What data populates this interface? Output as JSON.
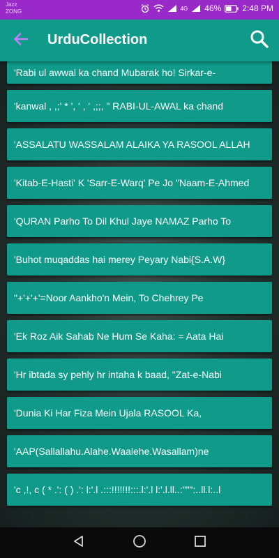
{
  "status_bar": {
    "carrier_line1": "Jazz",
    "carrier_line2": "ZONG",
    "network": "4G",
    "battery": "46%",
    "time": "2:48 PM"
  },
  "app_bar": {
    "title": "UrduCollection",
    "back_icon": "arrow-left-icon",
    "search_icon": "search-icon"
  },
  "colors": {
    "status_bar": "#9a29c9",
    "app_bar": "#0f9a8a",
    "card": "#0f9a8a",
    "back_arrow": "#c77dff",
    "nav_bar": "#0a0a0a"
  },
  "list": {
    "items": [
      "'Rabi ul awwal ka chand Mubarak ho!  Sirkar-e-",
      "'kanwal , ,;' * ', ' , ' ,;;, \"  RABI-UL-AWAL ka chand",
      "'ASSALATU WASSALAM ALAIKA YA RASOOL ALLAH",
      "'Kitab-E-Hasti' K 'Sarr-E-Warq' Pe Jo \"Naam-E-Ahmed",
      "'QURAN Parho To Dil Khul Jaye  NAMAZ Parho To",
      "'Buhot muqaddas hai merey Peyary Nabi{S.A.W}",
      "\"+'+'+'=Noor Aankho'n Mein, To Chehrey Pe",
      "'Ek Roz Aik Sahab Ne Hum Se Kaha: = Aata Hai",
      "'Hr ibtada sy pehly hr intaha k baad,  \"Zat-e-Nabi",
      "'Dunia Ki Har Fiza Mein Ujala RASOOL Ka,",
      "'AAP(Sallallahu.Alahe.Waalehe.Wasallam)ne",
      "'c ,!, c ( * .': ( ) .': l:'.l .:::!!!!!!!:::.l:'.l l:'.l.ll..:\"\"\":..ll.l:..l"
    ]
  },
  "nav_bar": {
    "back": "triangle-back-icon",
    "home": "circle-home-icon",
    "recents": "square-recents-icon"
  }
}
